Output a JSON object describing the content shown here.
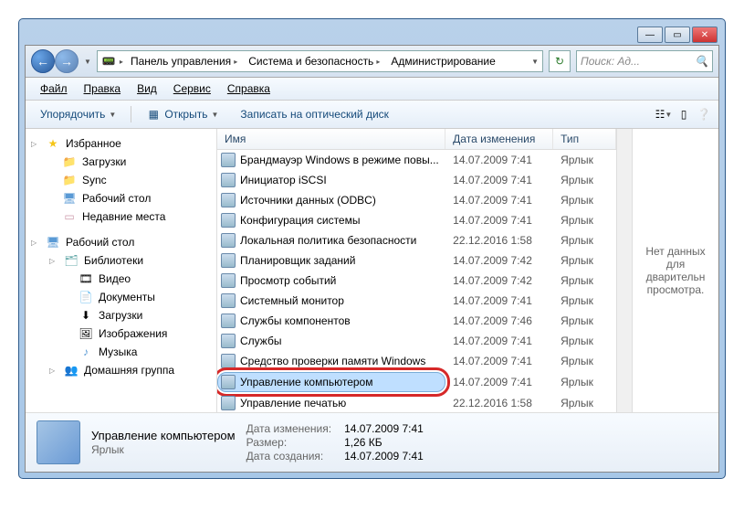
{
  "titlebar": {
    "minimize": "—",
    "maximize": "▭",
    "close": "✕"
  },
  "breadcrumb": [
    {
      "label": "Панель управления"
    },
    {
      "label": "Система и безопасность"
    },
    {
      "label": "Администрирование"
    }
  ],
  "search": {
    "placeholder": "Поиск: Ад..."
  },
  "menubar": [
    "Файл",
    "Правка",
    "Вид",
    "Сервис",
    "Справка"
  ],
  "toolbar": {
    "organize": "Упорядочить",
    "open": "Открыть",
    "burn": "Записать на оптический диск"
  },
  "sidebar": {
    "favorites": {
      "label": "Избранное",
      "items": [
        "Загрузки",
        "Sync",
        "Рабочий стол",
        "Недавние места"
      ]
    },
    "desktop": {
      "label": "Рабочий стол",
      "libs": {
        "label": "Библиотеки",
        "items": [
          "Видео",
          "Документы",
          "Загрузки",
          "Изображения",
          "Музыка"
        ]
      },
      "homegroup": "Домашняя группа"
    }
  },
  "columns": {
    "name": "Имя",
    "date": "Дата изменения",
    "type": "Тип"
  },
  "files": [
    {
      "name": "Брандмауэр Windows в режиме повы...",
      "date": "14.07.2009 7:41",
      "type": "Ярлык"
    },
    {
      "name": "Инициатор iSCSI",
      "date": "14.07.2009 7:41",
      "type": "Ярлык"
    },
    {
      "name": "Источники данных (ODBC)",
      "date": "14.07.2009 7:41",
      "type": "Ярлык"
    },
    {
      "name": "Конфигурация системы",
      "date": "14.07.2009 7:41",
      "type": "Ярлык"
    },
    {
      "name": "Локальная политика безопасности",
      "date": "22.12.2016 1:58",
      "type": "Ярлык"
    },
    {
      "name": "Планировщик заданий",
      "date": "14.07.2009 7:42",
      "type": "Ярлык"
    },
    {
      "name": "Просмотр событий",
      "date": "14.07.2009 7:42",
      "type": "Ярлык"
    },
    {
      "name": "Системный монитор",
      "date": "14.07.2009 7:41",
      "type": "Ярлык"
    },
    {
      "name": "Службы компонентов",
      "date": "14.07.2009 7:46",
      "type": "Ярлык"
    },
    {
      "name": "Службы",
      "date": "14.07.2009 7:41",
      "type": "Ярлык"
    },
    {
      "name": "Средство проверки памяти Windows",
      "date": "14.07.2009 7:41",
      "type": "Ярлык"
    },
    {
      "name": "Управление компьютером",
      "date": "14.07.2009 7:41",
      "type": "Ярлык",
      "selected": true,
      "highlighted": true
    },
    {
      "name": "Управление печатью",
      "date": "22.12.2016 1:58",
      "type": "Ярлык"
    }
  ],
  "preview": {
    "message": "Нет данных для дварительн просмотра."
  },
  "details": {
    "title": "Управление компьютером",
    "subtitle": "Ярлык",
    "date_lbl": "Дата изменения:",
    "date_val": "14.07.2009 7:41",
    "size_lbl": "Размер:",
    "size_val": "1,26 КБ",
    "created_lbl": "Дата создания:",
    "created_val": "14.07.2009 7:41"
  }
}
